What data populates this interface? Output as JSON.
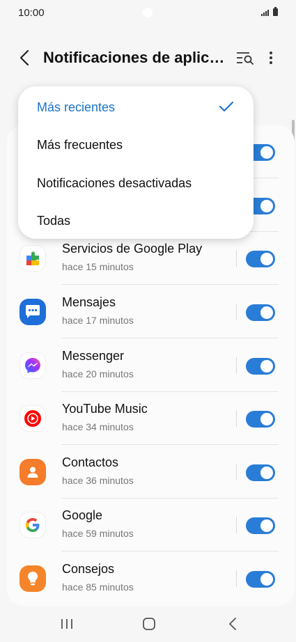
{
  "status_bar": {
    "time": "10:00"
  },
  "header": {
    "title": "Notificaciones de aplicaciones"
  },
  "dropdown": {
    "options": [
      {
        "label": "Más recientes",
        "selected": true
      },
      {
        "label": "Más frecuentes",
        "selected": false
      },
      {
        "label": "Notificaciones desactivadas",
        "selected": false
      },
      {
        "label": "Todas",
        "selected": false
      }
    ]
  },
  "apps": [
    {
      "name": "Servicios de Google Play",
      "time": "hace 15 minutos",
      "icon": "google-play-services-icon",
      "enabled": true
    },
    {
      "name": "Mensajes",
      "time": "hace 17 minutos",
      "icon": "messages-icon",
      "enabled": true
    },
    {
      "name": "Messenger",
      "time": "hace 20 minutos",
      "icon": "messenger-icon",
      "enabled": true
    },
    {
      "name": "YouTube Music",
      "time": "hace 34 minutos",
      "icon": "youtube-music-icon",
      "enabled": true
    },
    {
      "name": "Contactos",
      "time": "hace 36 minutos",
      "icon": "contacts-icon",
      "enabled": true
    },
    {
      "name": "Google",
      "time": "hace 59 minutos",
      "icon": "google-icon",
      "enabled": true
    },
    {
      "name": "Consejos",
      "time": "hace 85 minutos",
      "icon": "tips-icon",
      "enabled": true
    }
  ],
  "colors": {
    "accent": "#2a7dd6",
    "selected_text": "#1a73c8"
  }
}
